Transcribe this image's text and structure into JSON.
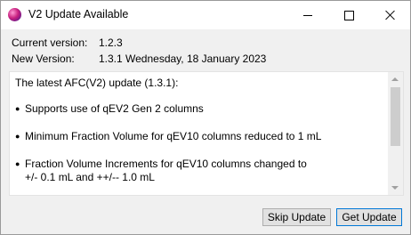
{
  "window": {
    "title": "V2 Update Available"
  },
  "info": {
    "current_label": "Current version:",
    "current_value": "1.2.3",
    "new_label": "New Version:",
    "new_value": "1.3.1 Wednesday, 18 January 2023"
  },
  "notes": {
    "intro": "The latest AFC(V2) update (1.3.1):",
    "bullets": [
      {
        "lines": [
          "Supports use of qEV2 Gen 2 columns"
        ]
      },
      {
        "lines": [
          "Minimum Fraction Volume for qEV10 columns reduced to 1 mL"
        ]
      },
      {
        "lines": [
          "Fraction Volume Increments for qEV10 columns changed to",
          "+/- 0.1 mL and ++/-- 1.0 mL"
        ]
      }
    ],
    "bullet_char": "●"
  },
  "buttons": {
    "skip_label": "Skip Update",
    "get_label": "Get Update"
  }
}
